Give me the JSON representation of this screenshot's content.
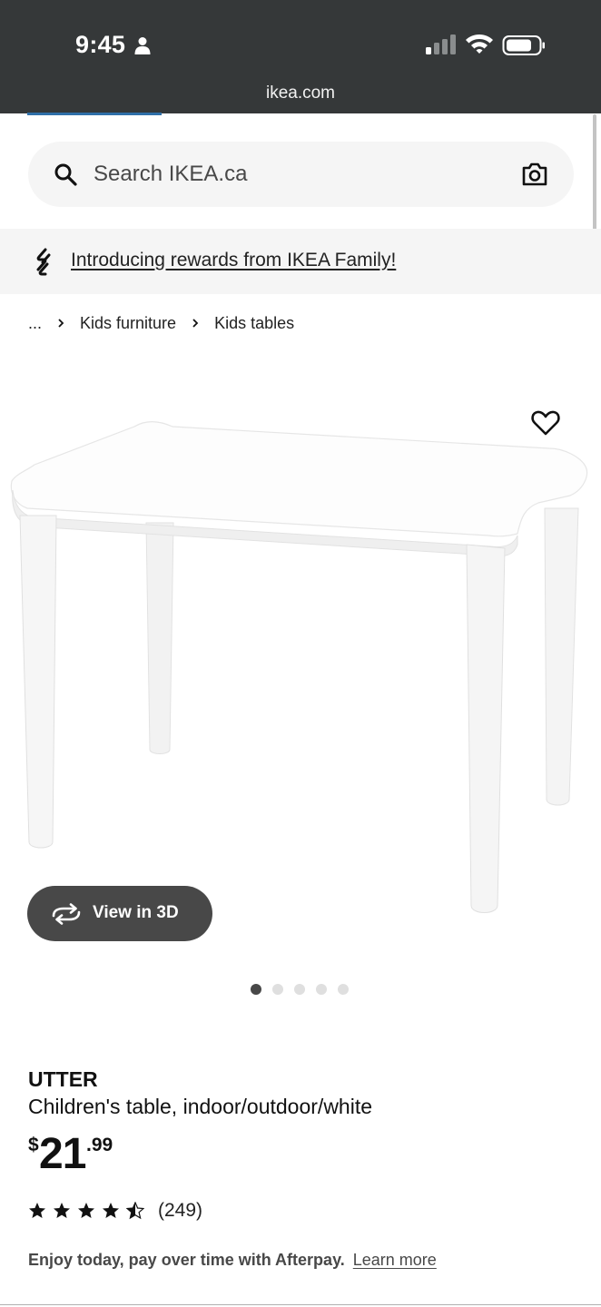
{
  "status_bar": {
    "time": "9:45"
  },
  "browser": {
    "url": "ikea.com"
  },
  "search": {
    "placeholder": "Search IKEA.ca"
  },
  "banner": {
    "link_text": "Introducing rewards from IKEA Family!"
  },
  "breadcrumb": {
    "items": [
      "...",
      "Kids furniture",
      "Kids tables"
    ]
  },
  "gallery": {
    "view3d_label": "View in 3D",
    "image_count": 5,
    "active_index": 0
  },
  "product": {
    "name": "UTTER",
    "description": "Children's table, indoor/outdoor/white",
    "price": {
      "currency": "$",
      "integer": "21",
      "decimal": ".99"
    },
    "rating": {
      "value": 4.5,
      "max": 5,
      "count_label": "(249)"
    }
  },
  "afterpay": {
    "text": "Enjoy today, pay over time with Afterpay.",
    "link": "Learn more"
  },
  "colors": {
    "status_bar_bg": "#353839",
    "button_dark": "#484848",
    "surface_light": "#f5f5f5",
    "text": "#111111"
  }
}
